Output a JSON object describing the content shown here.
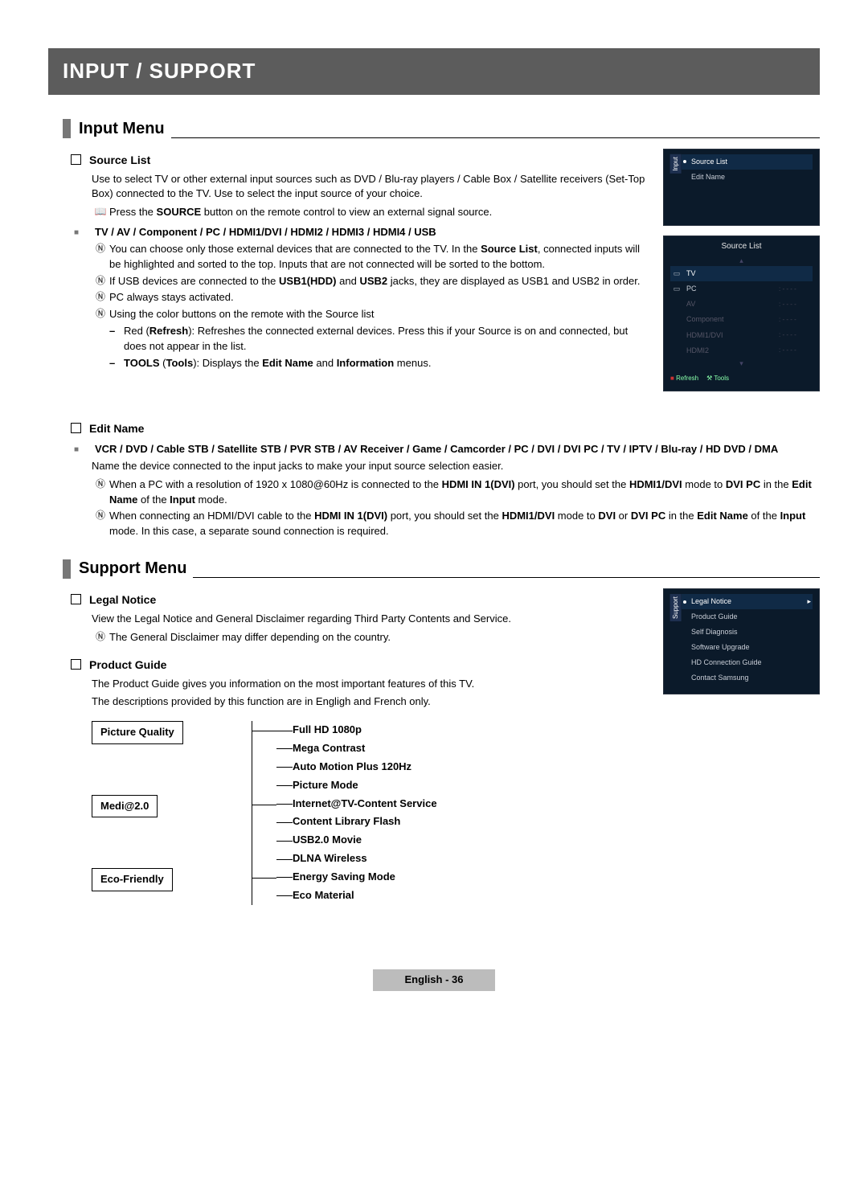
{
  "title_bar": "INPUT / SUPPORT",
  "section_input": "Input Menu",
  "section_support": "Support Menu",
  "source_list": {
    "heading": "Source List",
    "desc": "Use to select TV or other external input sources such as DVD / Blu-ray players / Cable Box / Satellite receivers (Set-Top Box) connected to the TV. Use to select the input source of your choice.",
    "remote_note_pre": "Press the ",
    "remote_note_b": "SOURCE",
    "remote_note_post": " button on the remote control to view an external signal source.",
    "modes_line": "TV / AV / Component / PC / HDMI1/DVI / HDMI2 / HDMI3 / HDMI4 / USB",
    "n1a": "You can choose only those external devices that are connected to the TV. In the ",
    "n1b": "Source List",
    "n1c": ", connected inputs will be highlighted and sorted to the top. Inputs that are not connected will be sorted to the bottom.",
    "n2a": "If USB devices are connected to the ",
    "n2b": "USB1(HDD)",
    "n2c": " and ",
    "n2d": "USB2",
    "n2e": " jacks, they are displayed as USB1 and USB2 in order.",
    "n3": "PC always stays activated.",
    "n4": "Using the color buttons on the remote with the Source list",
    "d1a": "Red (",
    "d1b": "Refresh",
    "d1c": "): Refreshes the connected external devices. Press this if your Source is on and connected, but does not appear in the list.",
    "d2a": "TOOLS",
    "d2b": " (",
    "d2c": "Tools",
    "d2d": "): Displays the ",
    "d2e": "Edit Name",
    "d2f": " and ",
    "d2g": "Information",
    "d2h": " menus."
  },
  "edit_name": {
    "heading": "Edit Name",
    "devices": "VCR / DVD / Cable STB / Satellite STB / PVR STB / AV Receiver / Game / Camcorder / PC / DVI / DVI PC / TV / IPTV / Blu-ray / HD DVD / DMA",
    "desc": "Name the device connected to the input jacks to make your input source selection easier.",
    "n1a": "When a PC with a resolution of 1920 x 1080@60Hz is connected to the ",
    "n1b": "HDMI IN 1(DVI)",
    "n1c": " port, you should set the ",
    "n1d": "HDMI1/DVI",
    "n1e": " mode to ",
    "n1f": "DVI PC",
    "n1g": " in the ",
    "n1h": "Edit Name",
    "n1i": " of the ",
    "n1j": "Input",
    "n1k": " mode.",
    "n2a": "When connecting an HDMI/DVI cable to the ",
    "n2b": "HDMI IN 1(DVI)",
    "n2c": " port, you should set the ",
    "n2d": "HDMI1/DVI",
    "n2e": " mode to ",
    "n2f": "DVI",
    "n2g": " or ",
    "n2h": "DVI PC",
    "n2i": " in the ",
    "n2j": "Edit Name",
    "n2k": " of the ",
    "n2l": "Input",
    "n2m": " mode. In this case, a separate sound connection is required."
  },
  "legal_notice": {
    "heading": "Legal Notice",
    "desc": "View the Legal Notice and General Disclaimer regarding Third Party Contents and Service.",
    "note": "The General Disclaimer may differ depending on the country."
  },
  "product_guide": {
    "heading": "Product Guide",
    "desc1": "The Product Guide gives you information on the most important features of this TV.",
    "desc2": "The descriptions provided by this function are in Engligh and French only.",
    "cats": [
      {
        "name": "Picture Quality",
        "items": [
          "Full HD 1080p",
          "Mega Contrast",
          "Auto Motion Plus 120Hz",
          "Picture Mode"
        ]
      },
      {
        "name": "Medi@2.0",
        "items": [
          "Internet@TV-Content Service",
          "Content Library Flash",
          "USB2.0 Movie",
          "DLNA Wireless"
        ]
      },
      {
        "name": "Eco-Friendly",
        "items": [
          "Energy Saving Mode",
          "Eco Material"
        ]
      }
    ]
  },
  "osd_input_menu": {
    "tab": "Input",
    "items": [
      "Source List",
      "Edit Name"
    ]
  },
  "osd_source_list": {
    "title": "Source List",
    "rows": [
      {
        "icon": "▭",
        "name": "TV",
        "status": ""
      },
      {
        "icon": "▭",
        "name": "PC",
        "status": ": - - - -"
      },
      {
        "icon": "",
        "name": "AV",
        "status": ": - - - -"
      },
      {
        "icon": "",
        "name": "Component",
        "status": ": - - - -"
      },
      {
        "icon": "",
        "name": "HDMI1/DVI",
        "status": ": - - - -"
      },
      {
        "icon": "",
        "name": "HDMI2",
        "status": ": - - - -"
      }
    ],
    "foot_refresh": "Refresh",
    "foot_tools": "Tools"
  },
  "osd_support_menu": {
    "tab": "Support",
    "highlight": "Legal Notice",
    "items": [
      "Product Guide",
      "Self Diagnosis",
      "Software Upgrade",
      "HD Connection Guide",
      "Contact Samsung"
    ]
  },
  "footer": {
    "lang": "English - ",
    "page": "36"
  },
  "glyphs": {
    "remote": "📱",
    "note": "Ⓝ",
    "square": "■",
    "red_dot": "■"
  }
}
